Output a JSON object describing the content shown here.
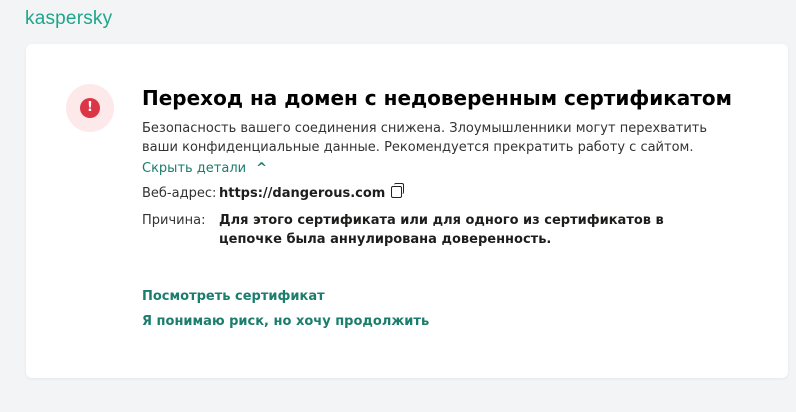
{
  "brand": "kaspersky",
  "title": "Переход на домен с недоверенным сертификатом",
  "description": "Безопасность вашего соединения снижена. Злоумышленники могут перехватить ваши конфиденциальные данные. Рекомендуется прекратить работу с сайтом.",
  "details_toggle": "Скрыть детали",
  "details": {
    "url_label": "Веб-адрес:",
    "url": "https://dangerous.com",
    "reason_label": "Причина:",
    "reason": "Для этого сертификата или для одного из сертификатов в цепочке была аннулирована доверенность."
  },
  "links": {
    "view_certificate": "Посмотреть сертификат",
    "proceed": "Я понимаю риск, но хочу продолжить"
  },
  "colors": {
    "accent": "#1b7d6b",
    "danger": "#dc3545"
  }
}
